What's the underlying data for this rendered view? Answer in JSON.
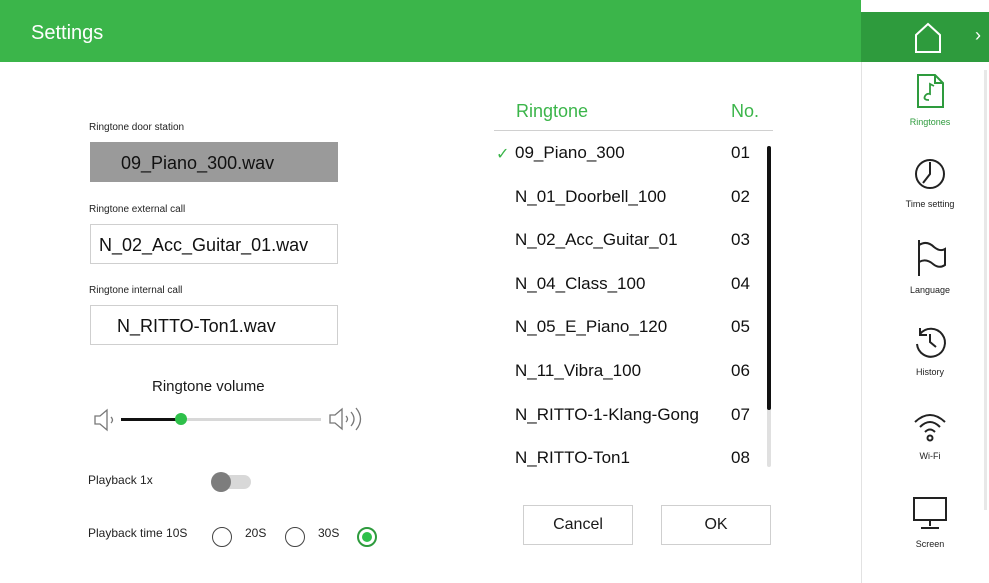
{
  "header": {
    "title": "Settings"
  },
  "nav": {
    "next_glyph": "›"
  },
  "form": {
    "door_label": "Ringtone door station",
    "door_value": "09_Piano_300.wav",
    "external_label": "Ringtone external call",
    "external_value": "N_02_Acc_Guitar_01.wav",
    "internal_label": "Ringtone internal call",
    "internal_value": "N_RITTO-Ton1.wav",
    "volume_label": "Ringtone volume",
    "volume_level": 0.3,
    "playback_label": "Playback 1x",
    "playback_on": false,
    "time_label": "Playback time 10S",
    "time_options": [
      "20S",
      "30S"
    ],
    "time_selected": "30S"
  },
  "list": {
    "header_name": "Ringtone",
    "header_no": "No.",
    "selected_index": 0,
    "rows": [
      {
        "name": "09_Piano_300",
        "no": "01"
      },
      {
        "name": "N_01_Doorbell_100",
        "no": "02"
      },
      {
        "name": "N_02_Acc_Guitar_01",
        "no": "03"
      },
      {
        "name": "N_04_Class_100",
        "no": "04"
      },
      {
        "name": "N_05_E_Piano_120",
        "no": "05"
      },
      {
        "name": "N_11_Vibra_100",
        "no": "06"
      },
      {
        "name": "N_RITTO-1-Klang-Gong",
        "no": "07"
      },
      {
        "name": "N_RITTO-Ton1",
        "no": "08"
      }
    ],
    "check_glyph": "✓"
  },
  "buttons": {
    "cancel": "Cancel",
    "ok": "OK"
  },
  "sidebar": {
    "items": [
      {
        "label": "Ringtones",
        "icon": "ringtone-file-icon",
        "active": true
      },
      {
        "label": "Time setting",
        "icon": "clock-icon"
      },
      {
        "label": "Language",
        "icon": "flag-icon"
      },
      {
        "label": "History",
        "icon": "history-icon"
      },
      {
        "label": "Wi-Fi",
        "icon": "wifi-icon"
      },
      {
        "label": "Screen",
        "icon": "monitor-icon"
      }
    ]
  },
  "colors": {
    "accent": "#3bb54a",
    "accent_dark": "#2e9b3d",
    "field_selected": "#9a9a9a"
  }
}
